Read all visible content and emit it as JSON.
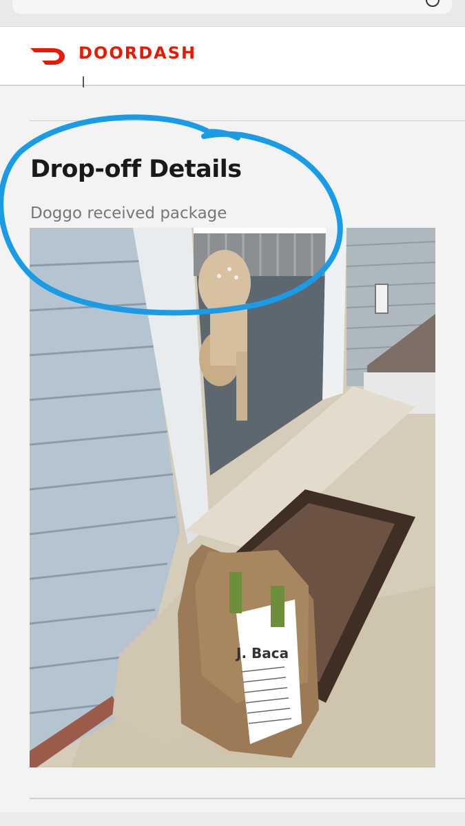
{
  "brand": {
    "name": "DOORDASH",
    "color": "#eb1700"
  },
  "dropoff": {
    "title": "Drop-off Details",
    "subtitle": "Doggo received package"
  },
  "photo": {
    "bag_label": "J. Baca"
  },
  "annotation": {
    "color": "#1a9be6"
  }
}
